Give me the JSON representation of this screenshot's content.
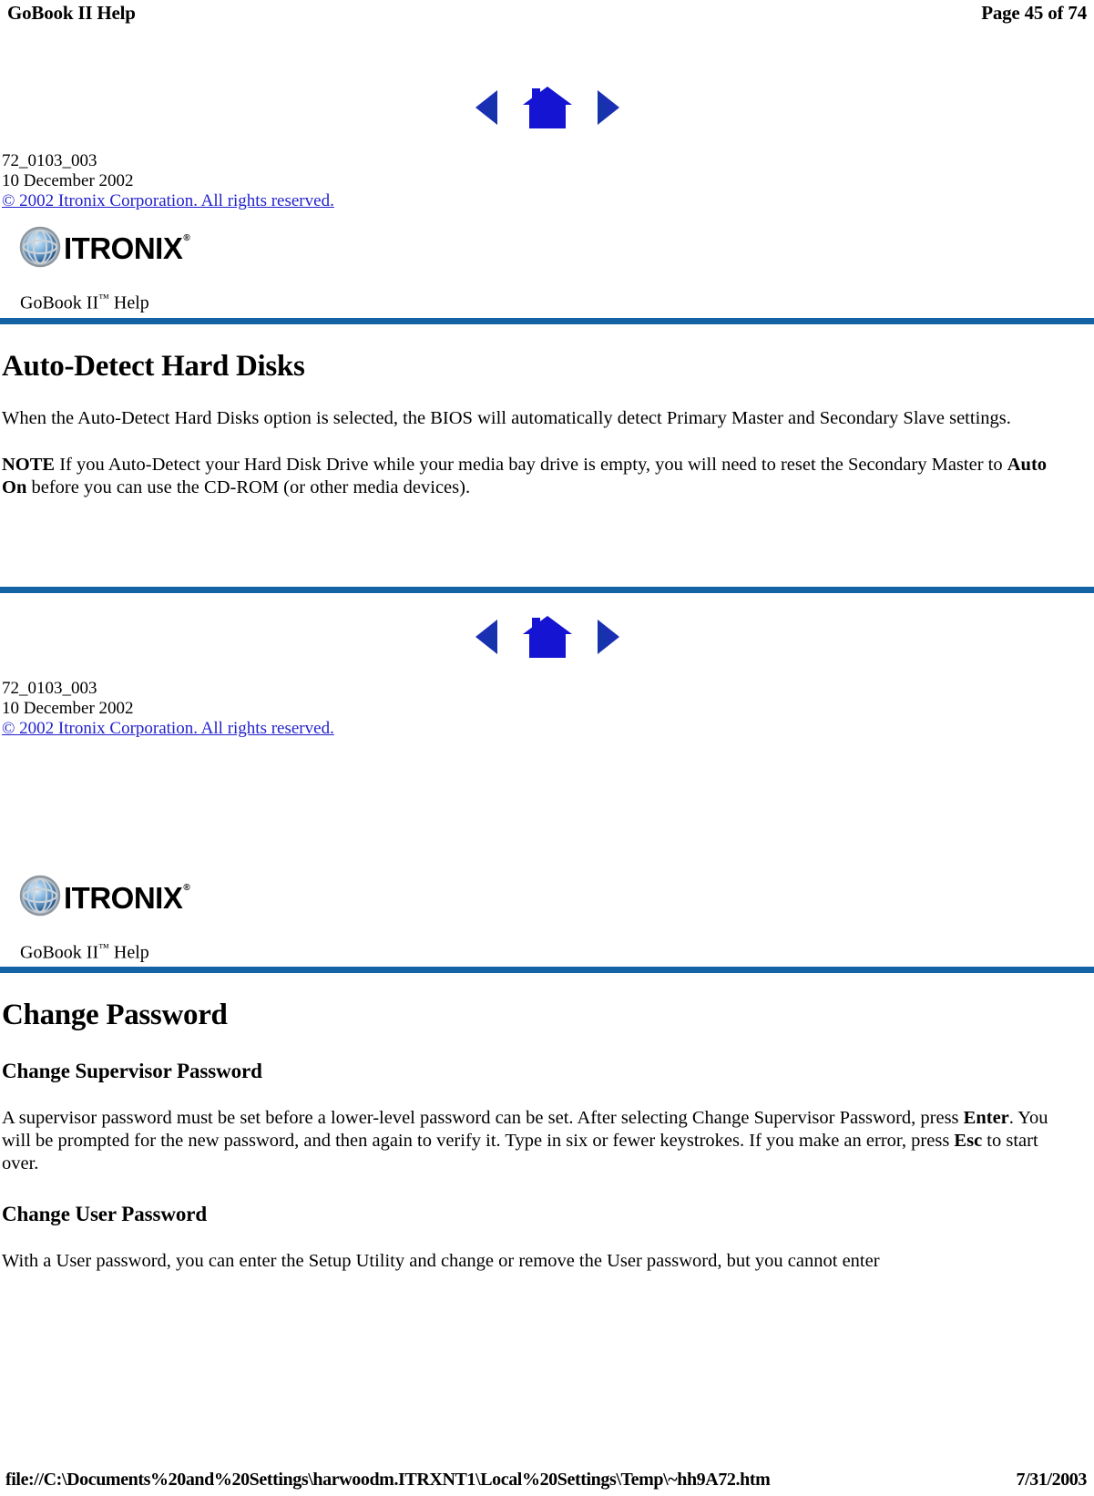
{
  "header": {
    "doc_title": "GoBook II Help",
    "page_indicator": "Page 45 of 74"
  },
  "nav": {
    "prev_label": "previous-page-arrow",
    "home_label": "home-button",
    "next_label": "next-page-arrow"
  },
  "meta": {
    "doc_number": "72_0103_003",
    "date": "10 December 2002",
    "copyright": "© 2002 Itronix Corporation.  All rights reserved."
  },
  "brand": {
    "logo_word": "ITRONIX",
    "logo_registered": "®",
    "help_label_pre": "GoBook II",
    "help_label_tm": "™",
    "help_label_post": " Help"
  },
  "sections": [
    {
      "title": "Auto-Detect Hard Disks",
      "paragraphs": [
        {
          "parts": [
            {
              "text": "When the Auto-Detect Hard Disks option is selected, the BIOS will automatically detect Primary Master and Secondary Slave settings.",
              "bold": false
            }
          ]
        },
        {
          "parts": [
            {
              "text": "NOTE",
              "bold": true
            },
            {
              "text": "  If you Auto-Detect your Hard Disk Drive while your media bay drive is empty, you will need to reset the Secondary Master to ",
              "bold": false
            },
            {
              "text": "Auto On",
              "bold": true
            },
            {
              "text": " before you can use the CD-ROM (or other media devices).",
              "bold": false
            }
          ]
        }
      ]
    },
    {
      "title": "Change Password",
      "subheadings": [
        {
          "title": "Change Supervisor Password",
          "paragraphs": [
            {
              "parts": [
                {
                  "text": "A supervisor password must be set before a lower-level password can be set.  After selecting Change Supervisor Password, press ",
                  "bold": false
                },
                {
                  "text": "Enter",
                  "bold": true
                },
                {
                  "text": ".  You will be prompted for the new password, and then again to verify it.  Type in six or fewer keystrokes.  If you make an error, press ",
                  "bold": false
                },
                {
                  "text": "Esc",
                  "bold": true
                },
                {
                  "text": " to start over.",
                  "bold": false
                }
              ]
            }
          ]
        },
        {
          "title": "Change User Password",
          "paragraphs": [
            {
              "parts": [
                {
                  "text": "With a User password, you can enter the Setup Utility and change or remove the User password, but you cannot enter",
                  "bold": false
                }
              ]
            }
          ]
        }
      ]
    }
  ],
  "footer": {
    "file_path": "file://C:\\Documents%20and%20Settings\\harwoodm.ITRXNT1\\Local%20Settings\\Temp\\~hh9A72.htm",
    "print_date": "7/31/2003"
  },
  "colors": {
    "rule_blue": "#1463a5",
    "nav_blue": "#1414d2",
    "link_blue": "#2222cc"
  }
}
